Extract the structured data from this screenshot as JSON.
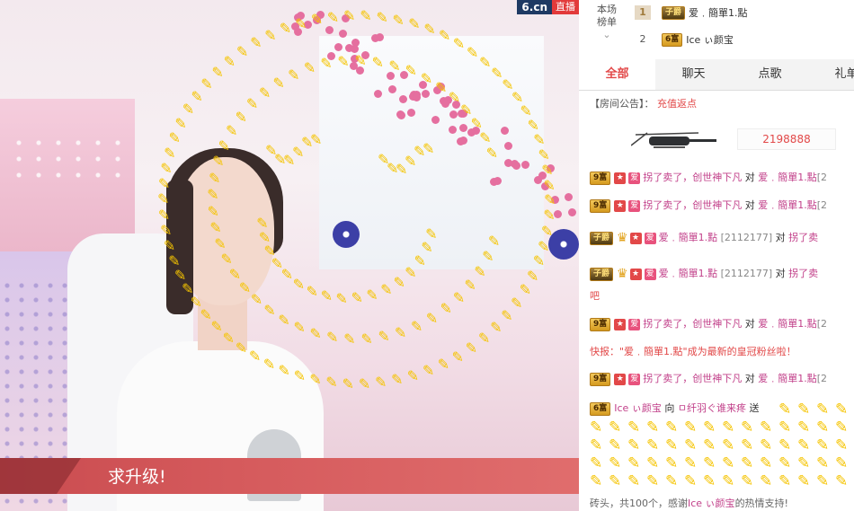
{
  "stream": {
    "logo": "6.cn",
    "live_badge": "直播",
    "banner_text": "求升级!"
  },
  "ranking": {
    "label_line1": "本场",
    "label_line2": "榜单",
    "rows": [
      {
        "rank": "1",
        "badge": "子爵",
        "name": "爱﹒簡單1.點"
      },
      {
        "rank": "2",
        "badge": "6富",
        "name": "Ice ぃ颜宝"
      }
    ]
  },
  "tabs": [
    "全部",
    "聊天",
    "点歌",
    "礼单"
  ],
  "notice": {
    "label": "【房间公告】",
    "colon": "：",
    "link": "充值返点"
  },
  "gift_counter": "2198888",
  "chat": [
    {
      "badge": "9富",
      "text": "拐了卖了，创世神下凡",
      "to": "对",
      "target": "爱﹒簡單1.點",
      "tail": "[2"
    },
    {
      "badge": "9富",
      "text": "拐了卖了，创世神下凡",
      "to": "对",
      "target": "爱﹒簡單1.點",
      "tail": "[2"
    },
    {
      "badge": "子爵",
      "name": "爱﹒簡單1.點",
      "id": "[2112177]",
      "to": "对",
      "text": "拐了卖"
    },
    {
      "badge": "子爵",
      "name": "爱﹒簡單1.點",
      "id": "[2112177]",
      "to": "对",
      "text": "拐了卖",
      "extra": "吧"
    },
    {
      "badge": "9富",
      "text": "拐了卖了，创世神下凡",
      "to": "对",
      "target": "爱﹒簡單1.點",
      "tail": "[2"
    },
    {
      "flash": "快报：\"爱﹒簡單1.點\"成为最新的皇冠粉丝啦！"
    },
    {
      "badge": "9富",
      "text": "拐了卖了，创世神下凡",
      "to": "对",
      "target": "爱﹒簡單1.點",
      "tail": "[2"
    },
    {
      "badge": "6富",
      "name": "Ice ぃ颜宝",
      "to": "向",
      "target": "ㅁ纤羽ぐ谁来疼",
      "action": "送"
    }
  ],
  "thanks": {
    "prefix": "砖头，共100个，感谢",
    "user": "Ice ぃ颜宝",
    "suffix": "的热情支持!"
  },
  "colors": {
    "accent": "#e24848",
    "user": "#c2408a",
    "gold": "#f5c400",
    "banner": "#d55a5c"
  }
}
